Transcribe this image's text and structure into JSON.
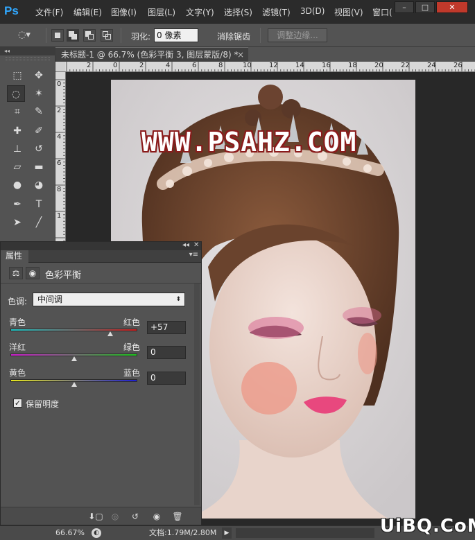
{
  "app": {
    "logo_text": "Ps"
  },
  "menu": {
    "items": [
      "文件(F)",
      "编辑(E)",
      "图像(I)",
      "图层(L)",
      "文字(Y)",
      "选择(S)",
      "滤镜(T)",
      "3D(D)",
      "视图(V)",
      "窗口("
    ]
  },
  "window_controls": {
    "minimize": "–",
    "restore": "□",
    "close": "✕"
  },
  "options": {
    "feather_label": "羽化:",
    "feather_value": "0 像素",
    "antialias_label": "消除锯齿",
    "antialias_checked": true,
    "refine_edge_label": "调整边缘..."
  },
  "document": {
    "tab_title": "未标题-1 @ 66.7% (色彩平衡 3, 图层蒙版/8) *",
    "tab_close": "×",
    "watermark": "WWW.PSAHZ.COM"
  },
  "rulers": {
    "h_labels": [
      "2",
      "0",
      "2",
      "4",
      "6",
      "8",
      "10",
      "12",
      "14",
      "16",
      "18",
      "20",
      "22",
      "24",
      "26"
    ],
    "v_labels": [
      "0",
      "2",
      "4",
      "6",
      "8",
      "1"
    ]
  },
  "tools": {
    "collapse": "◂◂",
    "items": [
      {
        "name": "rectangular-marquee-tool-icon",
        "glyph": "⬚"
      },
      {
        "name": "move-tool-icon",
        "glyph": "✥"
      },
      {
        "name": "lasso-tool-icon",
        "glyph": "◌"
      },
      {
        "name": "magic-wand-tool-icon",
        "glyph": "✶"
      },
      {
        "name": "crop-tool-icon",
        "glyph": "⌗"
      },
      {
        "name": "eyedropper-tool-icon",
        "glyph": "✎"
      },
      {
        "name": "healing-brush-tool-icon",
        "glyph": "✚"
      },
      {
        "name": "brush-tool-icon",
        "glyph": "✐"
      },
      {
        "name": "clone-stamp-tool-icon",
        "glyph": "⊥"
      },
      {
        "name": "history-brush-tool-icon",
        "glyph": "↺"
      },
      {
        "name": "eraser-tool-icon",
        "glyph": "▱"
      },
      {
        "name": "gradient-tool-icon",
        "glyph": "▬"
      },
      {
        "name": "blur-tool-icon",
        "glyph": "●"
      },
      {
        "name": "dodge-tool-icon",
        "glyph": "◕"
      },
      {
        "name": "pen-tool-icon",
        "glyph": "✒"
      },
      {
        "name": "type-tool-icon",
        "glyph": "T"
      },
      {
        "name": "path-selection-tool-icon",
        "glyph": "➤"
      },
      {
        "name": "line-tool-icon",
        "glyph": "╱"
      }
    ]
  },
  "properties": {
    "tab_label": "属性",
    "collapse": "◂◂",
    "close": "✕",
    "menu": "▾≡",
    "title": "色彩平衡",
    "tone_label": "色调:",
    "tone_value": "中间调",
    "sliders": [
      {
        "left": "青色",
        "right": "红色",
        "value": "+57",
        "fraction": 0.785,
        "gradient": [
          "#1ec8c8",
          "#d01e1e"
        ]
      },
      {
        "left": "洋红",
        "right": "绿色",
        "value": "0",
        "fraction": 0.5,
        "gradient": [
          "#d21ed2",
          "#1ec81e"
        ]
      },
      {
        "left": "黄色",
        "right": "蓝色",
        "value": "0",
        "fraction": 0.5,
        "gradient": [
          "#e6e61e",
          "#1e1ed2"
        ]
      }
    ],
    "preserve_label": "保留明度",
    "preserve_checked": true
  },
  "status": {
    "zoom": "66.67%",
    "doc_label": "文档:1.79M/2.80M",
    "arrow": "▶"
  },
  "site_logo": "UiBQ.CoM"
}
